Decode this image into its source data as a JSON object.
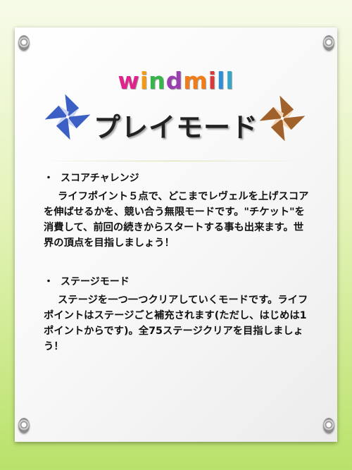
{
  "logo": {
    "letters": [
      {
        "ch": "w",
        "color": "#e0248c"
      },
      {
        "ch": "i",
        "color": "#f39a12"
      },
      {
        "ch": "n",
        "color": "#37b44a"
      },
      {
        "ch": "d",
        "color": "#9a3fb0"
      },
      {
        "ch": "m",
        "color": "#f07d1a"
      },
      {
        "ch": "i",
        "color": "#d63a3a"
      },
      {
        "ch": "l",
        "color": "#2c8fd8"
      },
      {
        "ch": "l",
        "color": "#33a6c9"
      }
    ]
  },
  "title": "プレイモード",
  "sections": [
    {
      "bullet": "・",
      "heading": "スコアチャレンジ",
      "body": "ライフポイント５点で、どこまでレヴェルを上げスコアを伸ばせるかを、競い合う無限モードです。\"チケット\"を消費して、前回の続きからスタートする事も出来ます。世界の頂点を目指しましょう！"
    },
    {
      "bullet": "・",
      "heading": "ステージモード",
      "body": "ステージを一つ一つクリアしていくモードです。ライフポイントはステージごと補充されます(ただし、はじめは1ポイントからです)。全75ステージクリアを目指しましょう！"
    }
  ],
  "icons": {
    "left_windmill": "windmill-blue-icon",
    "right_windmill": "windmill-brown-icon"
  },
  "colors": {
    "windmill_blue": "#3b5fc4",
    "windmill_brown": "#a0612b"
  }
}
